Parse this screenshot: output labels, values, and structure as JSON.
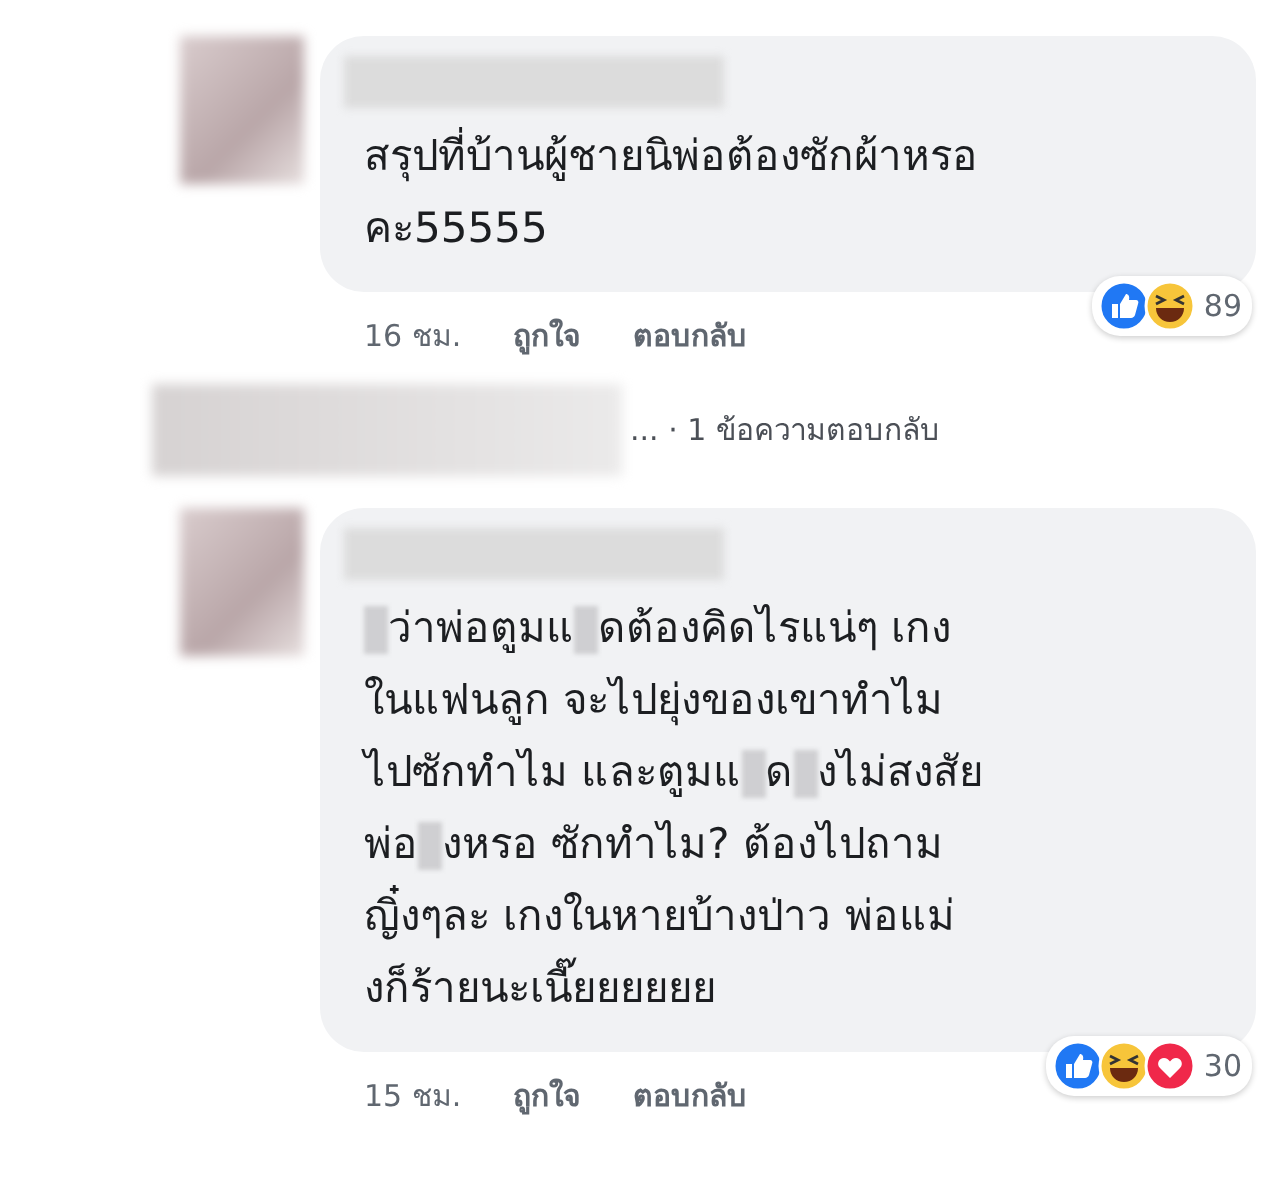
{
  "comments": [
    {
      "lines": [
        [
          {
            "kind": "text",
            "text": "สรุปที่บ้านผู้ชายนิพ่อต้องซักผ้าหรอ"
          }
        ],
        [
          {
            "kind": "text",
            "text": "คะ55555"
          }
        ]
      ],
      "time": "16 ชม.",
      "like": "ถูกใจ",
      "reply": "ตอบกลับ",
      "reactions": [
        {
          "kind": "like"
        },
        {
          "kind": "haha"
        }
      ],
      "reaction_count": "89",
      "replies": {
        "ellipsis": "...",
        "text": "· 1 ข้อความตอบกลับ"
      }
    },
    {
      "lines": [
        [
          {
            "kind": "blur"
          },
          {
            "kind": "text",
            "text": "ว่าพ่อตูมแ"
          },
          {
            "kind": "blur"
          },
          {
            "kind": "text",
            "text": "ดต้องคิดไรแน่ๆ เกง"
          }
        ],
        [
          {
            "kind": "text",
            "text": "ในแฟนลูก จะไปยุ่งของเขาทำไม"
          }
        ],
        [
          {
            "kind": "text",
            "text": "ไปซักทำไม และตูมแ"
          },
          {
            "kind": "blur"
          },
          {
            "kind": "text",
            "text": "ด"
          },
          {
            "kind": "blur"
          },
          {
            "kind": "text",
            "text": "งไม่สงสัย"
          }
        ],
        [
          {
            "kind": "text",
            "text": "พ่อ"
          },
          {
            "kind": "blur"
          },
          {
            "kind": "text",
            "text": "งหรอ ซักทำไม? ต้องไปถาม"
          }
        ],
        [
          {
            "kind": "text",
            "text": "ญิ๋งๆละ เกงในหายบ้างป่าว พ่อแม่"
          }
        ],
        [
          {
            "kind": "text",
            "text": "งก็ร้ายนะเนี๊ยยยยยย"
          }
        ]
      ],
      "time": "15 ชม.",
      "like": "ถูกใจ",
      "reply": "ตอบกลับ",
      "reactions": [
        {
          "kind": "like"
        },
        {
          "kind": "haha"
        },
        {
          "kind": "love"
        }
      ],
      "reaction_count": "30"
    }
  ]
}
